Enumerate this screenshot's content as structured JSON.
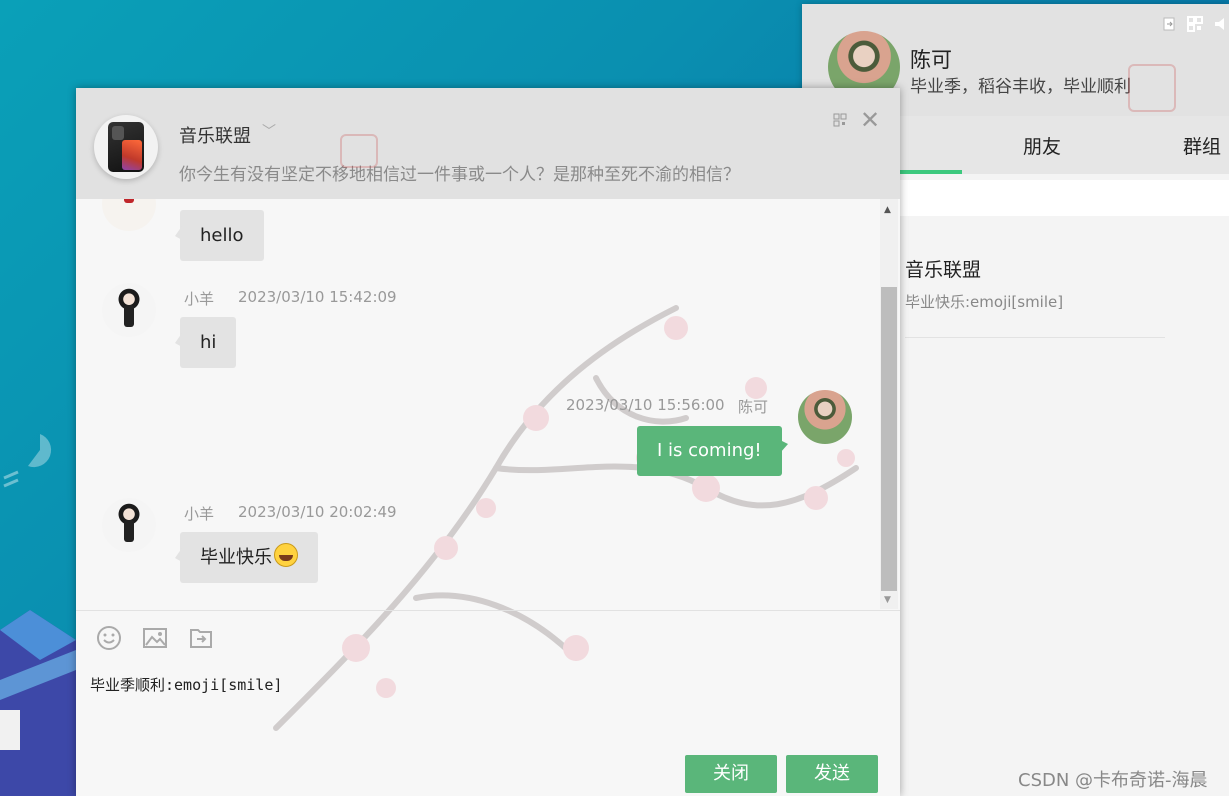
{
  "side_panel": {
    "user_name": "陈可",
    "user_signature": "毕业季，稻谷丰收，毕业顺利",
    "tabs": [
      {
        "label": "朋友"
      },
      {
        "label": "群组"
      }
    ],
    "active_tab_color": "#3dc97e",
    "contacts": [
      {
        "name": "音乐联盟",
        "last_message": "毕业快乐:emoji[smile]"
      }
    ]
  },
  "chat": {
    "group_name": "音乐联盟",
    "group_notice": "你今生有没有坚定不移地相信过一件事或一个人？是那种至死不渝的相信？",
    "messages": [
      {
        "side": "left",
        "text": "hello"
      },
      {
        "side": "left",
        "sender": "小羊",
        "time": "2023/03/10 15:42:09",
        "text": "hi"
      },
      {
        "side": "right",
        "sender": "陈可",
        "time": "2023/03/10 15:56:00",
        "text": "I is coming!"
      },
      {
        "side": "left",
        "sender": "小羊",
        "time": "2023/03/10 20:02:49",
        "text": "毕业快乐",
        "emoji": "grinning-face"
      }
    ],
    "input_value": "毕业季顺利:emoji[smile]",
    "toolbar": [
      "emoji-icon",
      "image-icon",
      "file-icon"
    ],
    "close_label": "关闭",
    "send_label": "发送",
    "button_color": "#5ab67a"
  },
  "watermark": "CSDN @卡布奇诺-海晨"
}
